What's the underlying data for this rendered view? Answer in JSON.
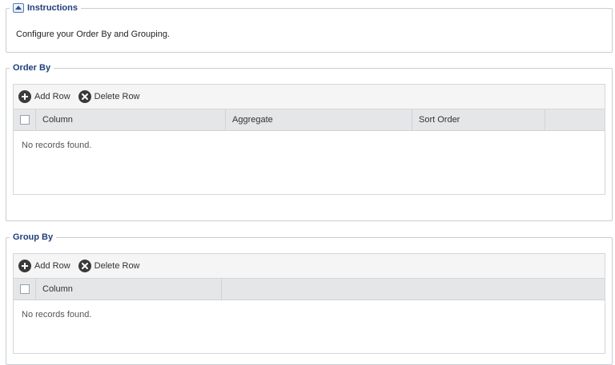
{
  "instructions": {
    "legend": "Instructions",
    "text": "Configure your Order By and Grouping."
  },
  "order_by": {
    "legend": "Order By",
    "toolbar": {
      "add_label": "Add Row",
      "delete_label": "Delete Row"
    },
    "columns": [
      "Column",
      "Aggregate",
      "Sort Order",
      ""
    ],
    "empty_message": "No records found."
  },
  "group_by": {
    "legend": "Group By",
    "toolbar": {
      "add_label": "Add Row",
      "delete_label": "Delete Row"
    },
    "columns": [
      "Column",
      ""
    ],
    "empty_message": "No records found."
  },
  "icons": {
    "collapse": "chevron-up-icon",
    "add": "plus-circle-icon",
    "delete": "x-circle-icon"
  },
  "colors": {
    "legend_text": "#1f3f7a",
    "icon_fill": "#3a3a3a",
    "header_bg": "#e5e6e8",
    "toolbar_bg": "#f5f5f5"
  }
}
